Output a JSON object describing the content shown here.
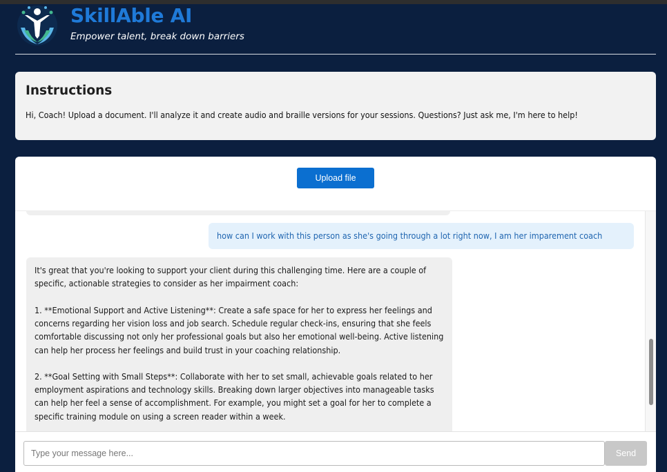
{
  "brand": {
    "title": "SkillAble AI",
    "tagline": "Empower talent, break down barriers",
    "colors": {
      "accent": "#1f7ad8",
      "background": "#0b1f3f"
    }
  },
  "instructions": {
    "heading": "Instructions",
    "text": "Hi, Coach! Upload a document. I'll analyze it and create audio and braille versions for your sessions. Questions? Just ask me, I'm here to help!"
  },
  "upload": {
    "label": "Upload file"
  },
  "conversation": {
    "user_message": "how can I work with this person as she's going through a lot right now, I am her imparement coach",
    "assistant_paragraphs": [
      "It's great that you're looking to support your client during this challenging time. Here are a couple of specific, actionable strategies to consider as her impairment coach:",
      "1. **Emotional Support and Active Listening**: Create a safe space for her to express her feelings and concerns regarding her vision loss and job search. Schedule regular check-ins, ensuring that she feels comfortable discussing not only her professional goals but also her emotional well-being. Active listening can help her process her feelings and build trust in your coaching relationship.",
      "2. **Goal Setting with Small Steps**: Collaborate with her to set small, achievable goals related to her employment aspirations and technology skills. Breaking down larger objectives into manageable tasks can help her feel a sense of accomplishment. For example, you might set a goal for her to complete a specific training module on using a screen reader within a week."
    ]
  },
  "composer": {
    "placeholder": "Type your message here...",
    "send_label": "Send"
  }
}
